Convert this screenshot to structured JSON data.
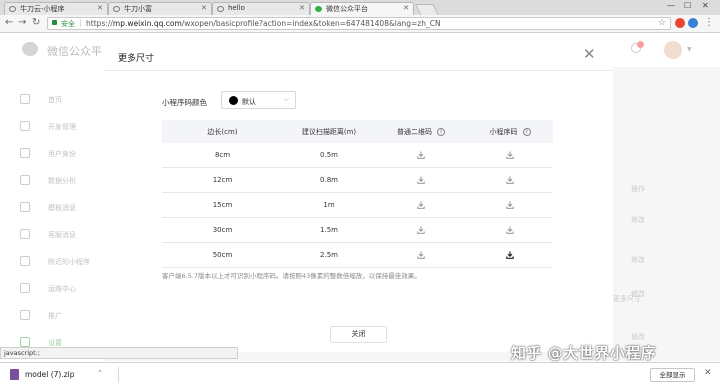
{
  "browser": {
    "tabs": [
      {
        "label": "牛刀云-小程序"
      },
      {
        "label": "牛刀小富"
      },
      {
        "label": "hello"
      },
      {
        "label": "微信公众平台"
      }
    ],
    "url_secure_label": "安全",
    "url_prefix": "https://",
    "url_host": "mp.weixin.qq.com",
    "url_path": "/wxopen/basicprofile?action=index&token=647481408&lang=zh_CN"
  },
  "page": {
    "brand": "微信公众平",
    "sidebar": [
      {
        "label": "首页"
      },
      {
        "label": "开发管理"
      },
      {
        "label": "用户身份"
      },
      {
        "label": "数据分析"
      },
      {
        "label": "模板消息"
      },
      {
        "label": "客服消息"
      },
      {
        "label": "附近的小程序"
      },
      {
        "label": "运维中心"
      },
      {
        "label": "推广"
      },
      {
        "label": "设置"
      }
    ],
    "bg_texts": [
      "操作",
      "修改",
      "修改",
      "修改",
      "更多尺寸",
      "修改"
    ]
  },
  "modal": {
    "title": "更多尺寸",
    "color_label": "小程序码颜色",
    "color_value": "默认",
    "color_swatch": "#000000",
    "table": {
      "headers": [
        "边长(cm)",
        "建议扫描距离(m)",
        "普通二维码",
        "小程序码"
      ],
      "rows": [
        {
          "size": "8cm",
          "distance": "0.5m"
        },
        {
          "size": "12cm",
          "distance": "0.8m"
        },
        {
          "size": "15cm",
          "distance": "1m"
        },
        {
          "size": "30cm",
          "distance": "1.5m"
        },
        {
          "size": "50cm",
          "distance": "2.5m"
        }
      ]
    },
    "note": "客户端6.5.7版本以上才可识别小程序码。请按照43像素的整数倍缩放，以保持最佳效果。",
    "close_button": "关闭"
  },
  "status_text": "javascript:;",
  "download": {
    "filename": "model (7).zip",
    "show_all": "全部显示"
  },
  "watermark": "知乎 @大世界小程序",
  "colors": {
    "accent_green": "#1aad19",
    "secure_green": "#1e8e3e"
  }
}
